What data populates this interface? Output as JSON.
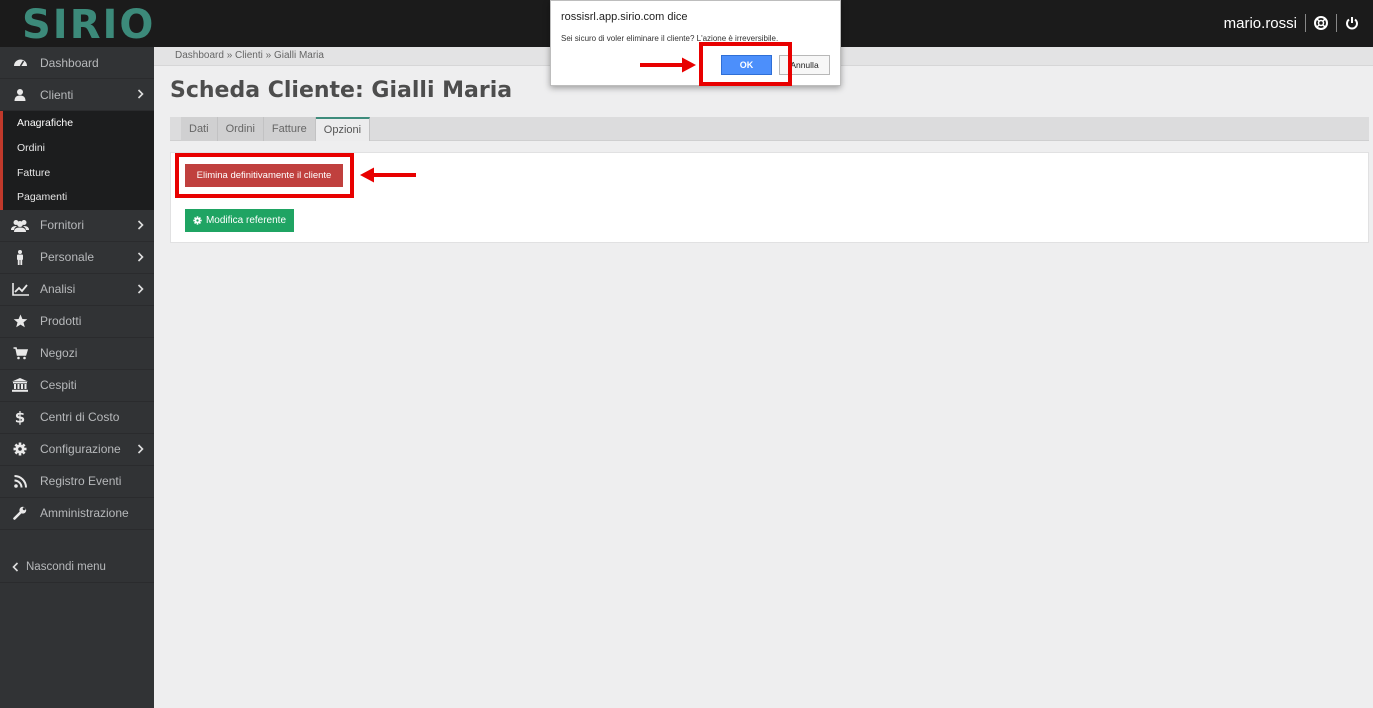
{
  "app": {
    "logo": "SIRIO",
    "username": "mario.rossi"
  },
  "sidebar": {
    "items": [
      {
        "label": "Dashboard",
        "icon": "dashboard-icon",
        "has_submenu": false
      },
      {
        "label": "Clienti",
        "icon": "user-icon",
        "has_submenu": true
      },
      {
        "label": "Fornitori",
        "icon": "users-icon",
        "has_submenu": true
      },
      {
        "label": "Personale",
        "icon": "person-icon",
        "has_submenu": true
      },
      {
        "label": "Analisi",
        "icon": "line-chart-icon",
        "has_submenu": true
      },
      {
        "label": "Prodotti",
        "icon": "star-icon",
        "has_submenu": false
      },
      {
        "label": "Negozi",
        "icon": "cart-icon",
        "has_submenu": false
      },
      {
        "label": "Cespiti",
        "icon": "bank-icon",
        "has_submenu": false
      },
      {
        "label": "Centri di Costo",
        "icon": "dollar-icon",
        "has_submenu": false
      },
      {
        "label": "Configurazione",
        "icon": "gear-icon",
        "has_submenu": true
      },
      {
        "label": "Registro Eventi",
        "icon": "rss-icon",
        "has_submenu": false
      },
      {
        "label": "Amministrazione",
        "icon": "wrench-icon",
        "has_submenu": false
      }
    ],
    "clienti_submenu": [
      "Anagrafiche",
      "Ordini",
      "Fatture",
      "Pagamenti"
    ],
    "hide_menu_label": "Nascondi menu"
  },
  "breadcrumb": "Dashboard » Clienti » Gialli Maria",
  "page_title": "Scheda Cliente: Gialli Maria",
  "tabs": [
    {
      "label": "Dati",
      "active": false
    },
    {
      "label": "Ordini",
      "active": false
    },
    {
      "label": "Fatture",
      "active": false
    },
    {
      "label": "Opzioni",
      "active": true
    }
  ],
  "buttons": {
    "delete_label": "Elimina definitivamente il cliente",
    "edit_label": "Modifica referente"
  },
  "dialog": {
    "title": "rossisrl.app.sirio.com dice",
    "message": "Sei sicuro di voler eliminare il cliente? L'azione è irreversibile.",
    "ok_label": "OK",
    "cancel_label": "Annulla"
  },
  "colors": {
    "accent": "#3e8c7c",
    "danger": "#c0403e",
    "success": "#1fa463",
    "highlight": "#e80000",
    "dialog_ok": "#4c8ffb"
  }
}
